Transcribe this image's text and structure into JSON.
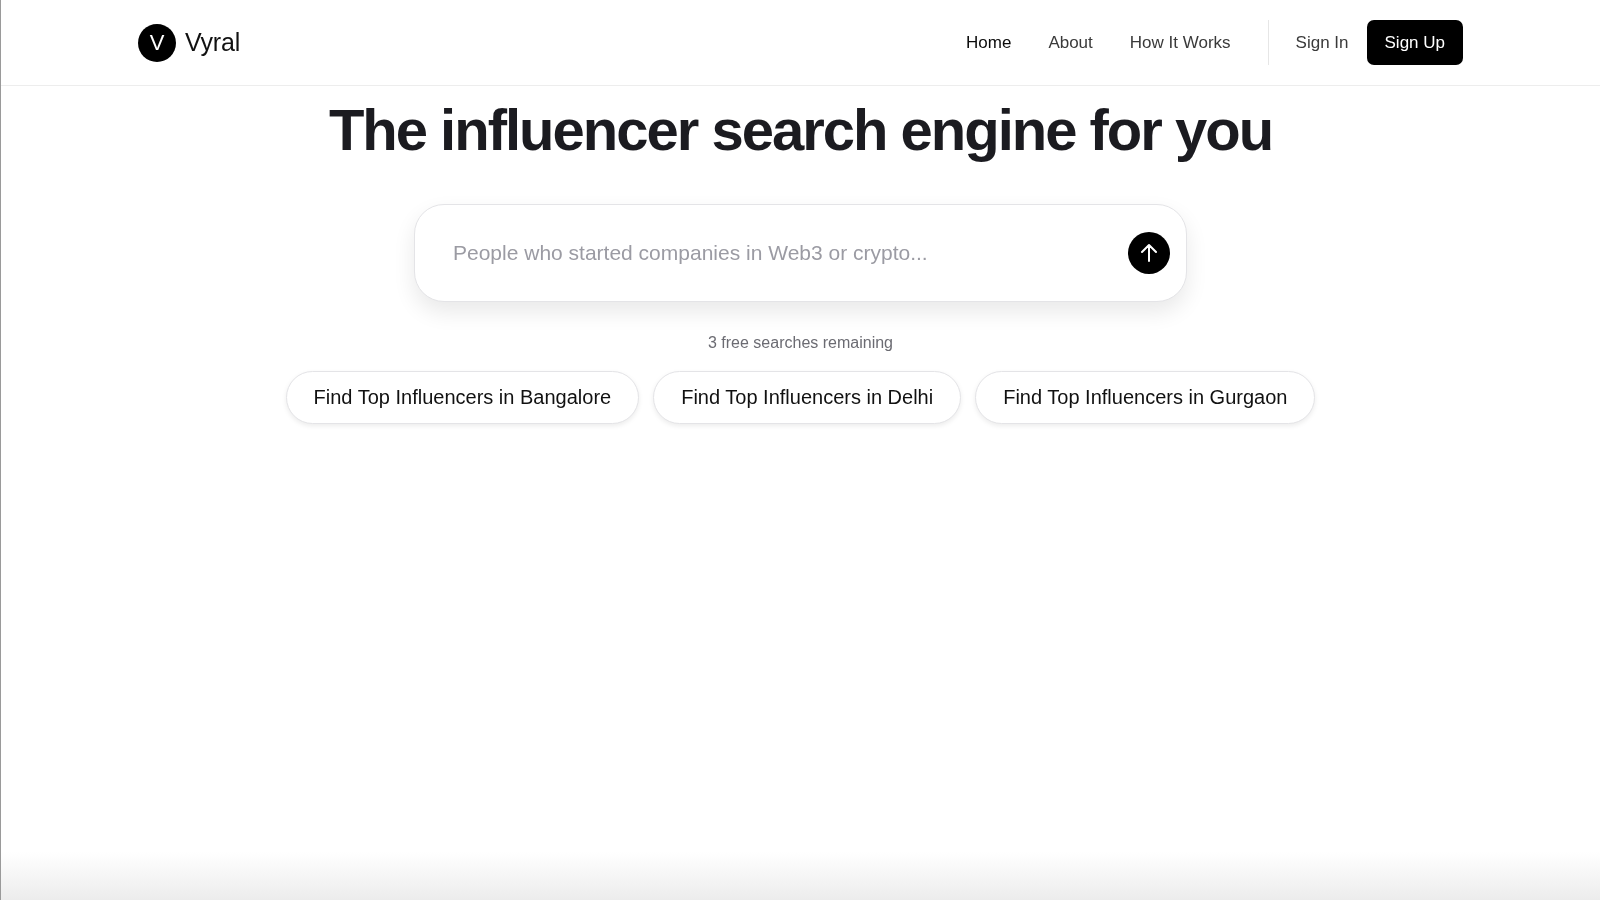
{
  "header": {
    "logo": {
      "letter": "V",
      "name": "Vyral"
    },
    "nav": [
      {
        "label": "Home",
        "selected": true
      },
      {
        "label": "About",
        "selected": false
      },
      {
        "label": "How It Works",
        "selected": false
      }
    ],
    "sign_in": "Sign In",
    "sign_up": "Sign Up"
  },
  "hero": {
    "title": "The influencer search engine for you",
    "search": {
      "placeholder": "People who started companies in Web3 or crypto..."
    },
    "remaining": "3 free searches remaining",
    "suggestions": [
      "Find Top Influencers in Bangalore",
      "Find Top Influencers in Delhi",
      "Find Top Influencers in Gurgaon"
    ]
  }
}
